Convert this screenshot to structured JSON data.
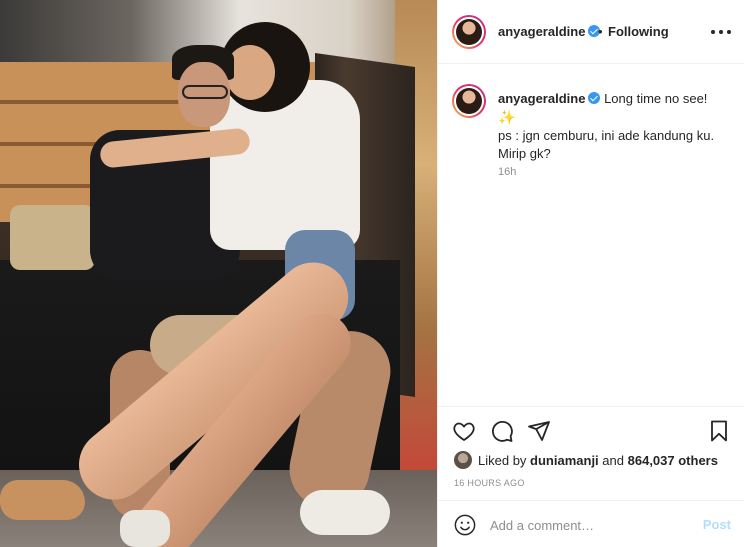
{
  "post": {
    "username": "anyageraldine",
    "follow_status": "Following",
    "bullet": "•"
  },
  "caption": {
    "username": "anyageraldine",
    "line1": "Long time no see!",
    "sparkle": "✨",
    "line2": "ps : jgn cemburu, ini ade kandung ku. Mirip gk?",
    "time": "16h"
  },
  "likes": {
    "prefix": "Liked by",
    "liker": "duniamanji",
    "conjunction": "and",
    "count": "864,037 others"
  },
  "posted_ago": "16 HOURS AGO",
  "comment": {
    "placeholder": "Add a comment…",
    "post_label": "Post"
  },
  "icons": {
    "verified": "verified-badge-icon",
    "like": "heart-icon",
    "comment": "comment-bubble-icon",
    "share": "paper-plane-icon",
    "save": "bookmark-icon",
    "emoji": "smiley-icon",
    "more": "more-dots-icon"
  },
  "colors": {
    "verified": "#3897f0",
    "post_button_disabled": "#b2dffc",
    "muted_text": "#8e8e8e",
    "text": "#262626"
  }
}
